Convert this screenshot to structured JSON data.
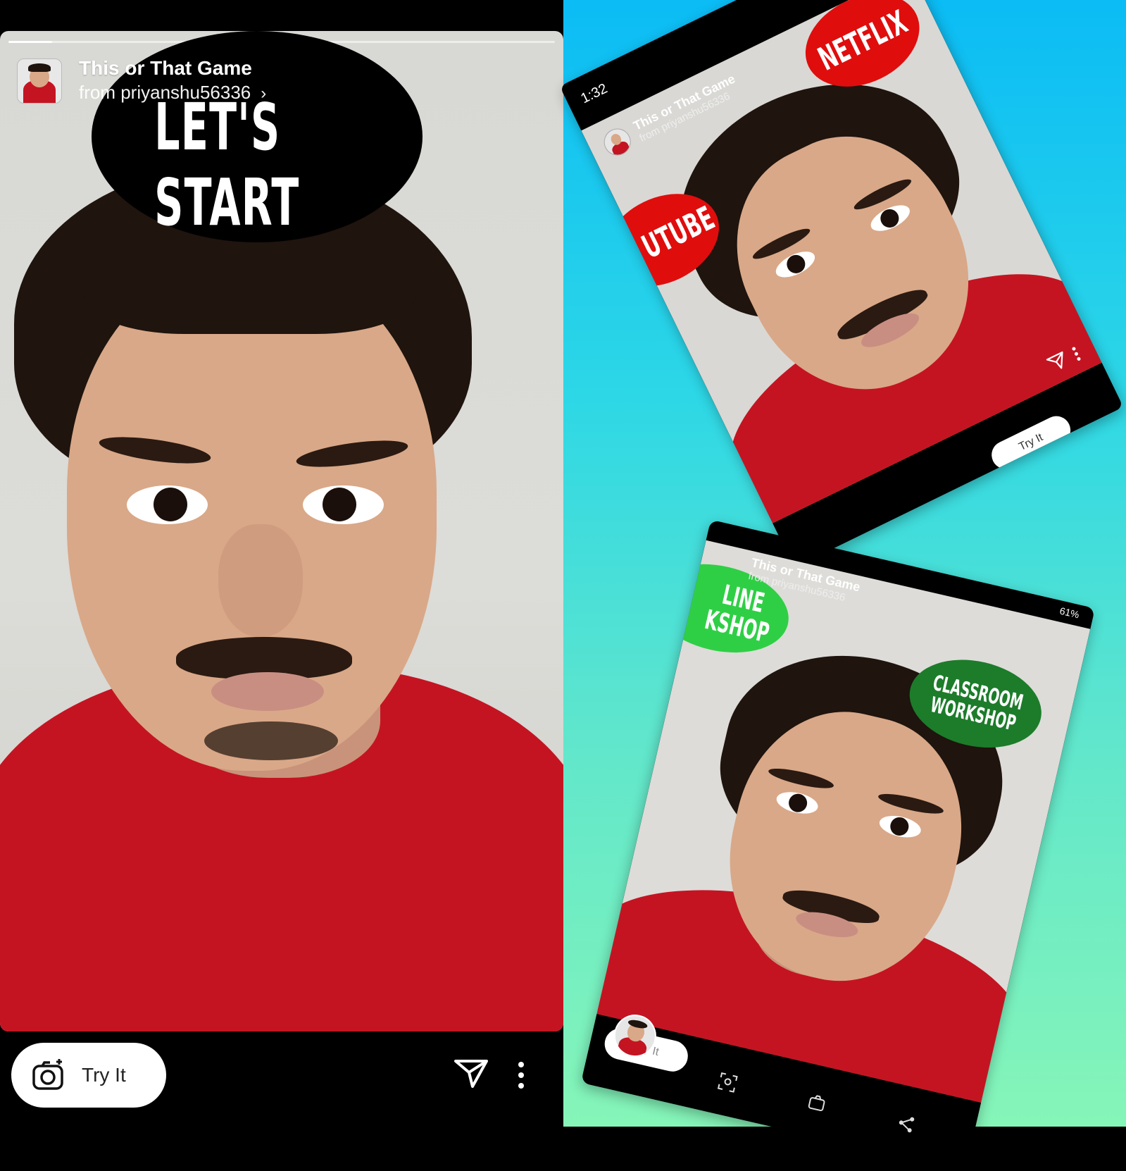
{
  "main_story": {
    "title": "This or That Game",
    "subtitle": "from priyanshu56336",
    "sticker_text": "LET'S START",
    "try_label": "Try It",
    "progress": 0.08
  },
  "story_top_right": {
    "status_time": "1:32",
    "title": "This or That Game",
    "subtitle": "from priyanshu56336",
    "option_a": "NETFLIX",
    "option_b": "UTUBE",
    "try_label": "Try It"
  },
  "story_bottom_right": {
    "status": "61%",
    "title": "This or That Game",
    "subtitle": "from priyanshu56336",
    "option_a_line1": "LINE",
    "option_a_line2": "KSHOP",
    "option_b_line1": "CLASSROOM",
    "option_b_line2": "WORKSHOP",
    "try_label": "Try It"
  },
  "colors": {
    "red_sticker": "#e00d0d",
    "green_light": "#2fcf45",
    "green_dark": "#1c7c2a",
    "shirt": "#c41422",
    "bg_top": "#0bbcf5",
    "bg_bottom": "#86f5b8"
  },
  "icons": [
    "camera-icon",
    "send-icon",
    "more-icon",
    "chevron-right-icon",
    "avatar"
  ]
}
